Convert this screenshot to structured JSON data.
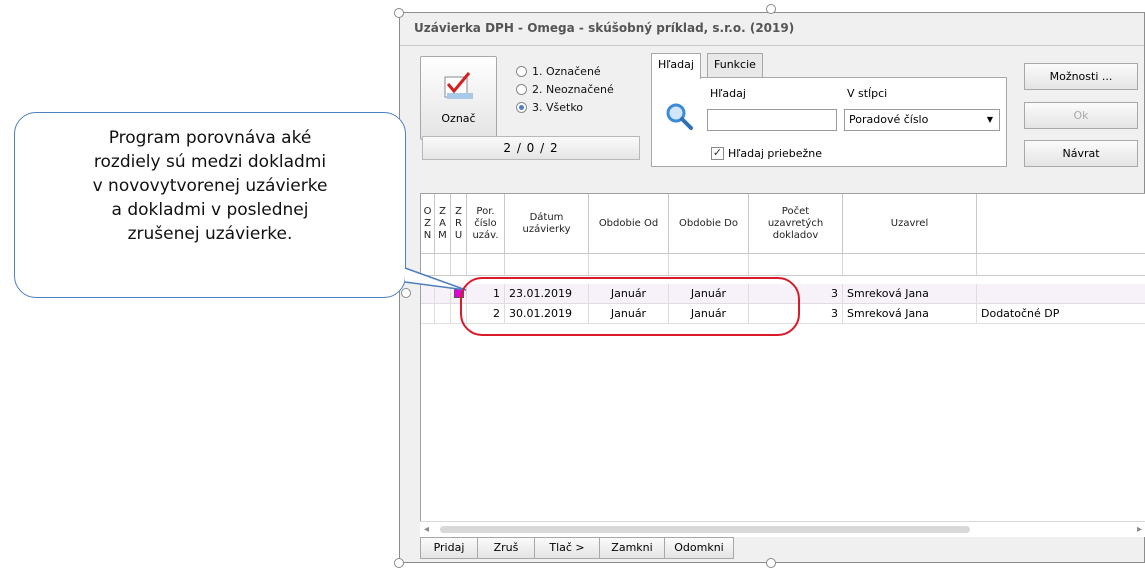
{
  "window": {
    "title": "Uzávierka DPH - Omega - skúšobný príklad, s.r.o. (2019)"
  },
  "mark_button": {
    "label": "Označ",
    "icon": "checkmark-icon"
  },
  "filter_options": [
    {
      "label": "1. Označené",
      "selected": false
    },
    {
      "label": "2. Neoznačené",
      "selected": false
    },
    {
      "label": "3. Všetko",
      "selected": true
    }
  ],
  "counter": "2 / 0 / 2",
  "tabs": [
    {
      "label": "Hľadaj",
      "active": true
    },
    {
      "label": "Funkcie",
      "active": false
    }
  ],
  "search": {
    "find_label": "Hľadaj",
    "find_value": "",
    "column_label": "V stĺpci",
    "column_value": "Poradové číslo",
    "incremental_label": "Hľadaj priebežne",
    "incremental_checked": true,
    "icon": "magnifier-icon"
  },
  "side_buttons": [
    {
      "label": "Možnosti ...",
      "enabled": true
    },
    {
      "label": "Ok",
      "enabled": false
    },
    {
      "label": "Návrat",
      "enabled": true
    }
  ],
  "grid": {
    "columns": [
      {
        "label": "O\nZ\nN"
      },
      {
        "label": "Z\nA\nM"
      },
      {
        "label": "Z\nR\nU"
      },
      {
        "label": "Por.\nčíslo\nuzáv."
      },
      {
        "label": "Dátum\nuzávierky"
      },
      {
        "label": "Obdobie Od"
      },
      {
        "label": "Obdobie Do"
      },
      {
        "label": "Počet\nuzavretých\ndokladov"
      },
      {
        "label": "Uzavrel"
      },
      {
        "label": ""
      }
    ],
    "rows": [
      {
        "ozn": "",
        "zam": "",
        "zru": "",
        "num": "1",
        "date": "23.01.2019",
        "from": "Január",
        "to": "Január",
        "count": "3",
        "by": "Smreková Jana",
        "note": ""
      },
      {
        "ozn": "",
        "zam": "",
        "zru": "",
        "num": "2",
        "date": "30.01.2019",
        "from": "Január",
        "to": "Január",
        "count": "3",
        "by": "Smreková Jana",
        "note": "Dodatočné DP"
      }
    ],
    "marker_color": "#e000e0"
  },
  "bottom_buttons": [
    {
      "label": "Pridaj"
    },
    {
      "label": "Zruš"
    },
    {
      "label": "Tlač >"
    },
    {
      "label": "Zamkni"
    },
    {
      "label": "Odomkni"
    }
  ],
  "callout": {
    "lines": [
      "Program porovnáva aké",
      "rozdiely sú medzi dokladmi",
      "v novovytvorenej uzávierke",
      "a dokladmi v poslednej",
      "zrušenej uzávierke."
    ],
    "border_color": "#4e80c0"
  },
  "highlight_color": "#d91a2a"
}
